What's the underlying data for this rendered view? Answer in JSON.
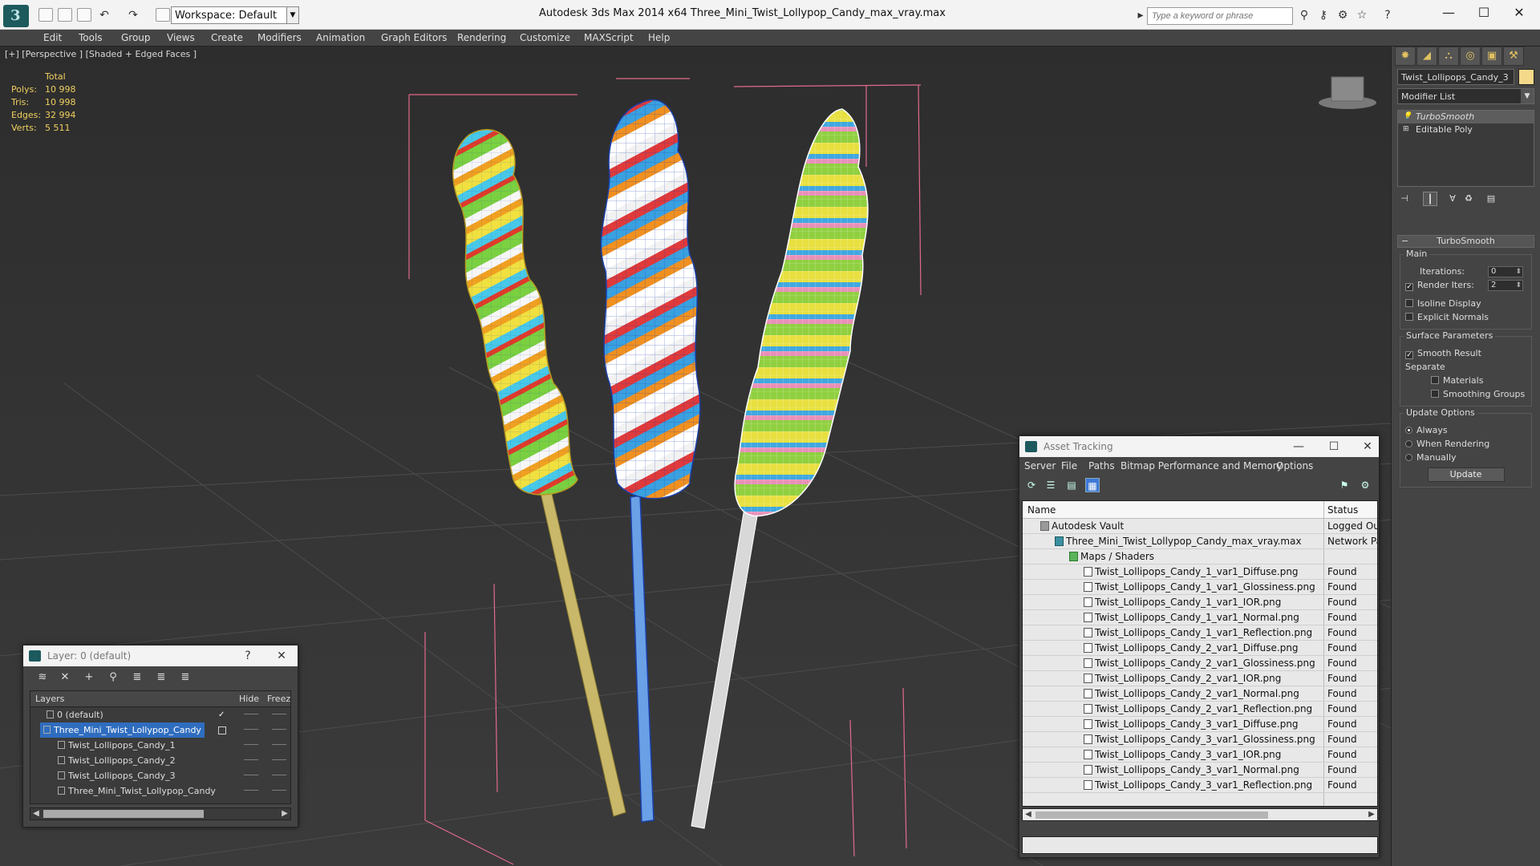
{
  "app": {
    "title": "Autodesk 3ds Max  2014 x64     Three_Mini_Twist_Lollypop_Candy_max_vray.max",
    "workspace": "Workspace: Default",
    "search_placeholder": "Type a keyword or phrase"
  },
  "menu": [
    "Edit",
    "Tools",
    "Group",
    "Views",
    "Create",
    "Modifiers",
    "Animation",
    "Graph Editors",
    "Rendering",
    "Customize",
    "MAXScript",
    "Help"
  ],
  "viewport": {
    "label": "[+] [Perspective ] [Shaded + Edged Faces ]",
    "stats": {
      "header": "Total",
      "rows": [
        {
          "label": "Polys:",
          "value": "10 998"
        },
        {
          "label": "Tris:",
          "value": "10 998"
        },
        {
          "label": "Edges:",
          "value": "32 994"
        },
        {
          "label": "Verts:",
          "value": "5 511"
        }
      ]
    }
  },
  "command_panel": {
    "object_name": "Twist_Lollipops_Candy_3",
    "object_color": "#f4d98a",
    "modifier_list": "Modifier List",
    "stack": [
      {
        "label": "TurboSmooth",
        "selected": true
      },
      {
        "label": "Editable Poly",
        "selected": false
      }
    ],
    "turbosmooth": {
      "title": "TurboSmooth",
      "main_label": "Main",
      "iterations_label": "Iterations:",
      "iterations_value": "0",
      "render_iters_label": "Render Iters:",
      "render_iters_value": "2",
      "isoline_label": "Isoline Display",
      "explicit_normals_label": "Explicit Normals",
      "surface_label": "Surface Parameters",
      "smooth_result_label": "Smooth Result",
      "separate_label": "Separate",
      "materials_label": "Materials",
      "smoothing_groups_label": "Smoothing Groups",
      "update_options_label": "Update Options",
      "always_label": "Always",
      "when_rendering_label": "When Rendering",
      "manually_label": "Manually",
      "update_button": "Update"
    }
  },
  "layer_dialog": {
    "title": "Layer: 0 (default)",
    "help": "?",
    "close": "✕",
    "col_layers": "Layers",
    "col_hide": "Hide",
    "col_freeze": "Freez",
    "rows": [
      {
        "name": "0 (default)",
        "indent": 1,
        "selected": false,
        "check": "✓"
      },
      {
        "name": "Three_Mini_Twist_Lollypop_Candy",
        "indent": 1,
        "selected": true,
        "check": ""
      },
      {
        "name": "Twist_Lollipops_Candy_1",
        "indent": 2,
        "selected": false,
        "check": ""
      },
      {
        "name": "Twist_Lollipops_Candy_2",
        "indent": 2,
        "selected": false,
        "check": ""
      },
      {
        "name": "Twist_Lollipops_Candy_3",
        "indent": 2,
        "selected": false,
        "check": ""
      },
      {
        "name": "Three_Mini_Twist_Lollypop_Candy",
        "indent": 2,
        "selected": false,
        "check": ""
      }
    ]
  },
  "asset_dialog": {
    "title": "Asset Tracking",
    "menu": [
      "Server",
      "File",
      "Paths",
      "Bitmap Performance and Memory",
      "Options"
    ],
    "col_name": "Name",
    "col_status": "Status",
    "rows": [
      {
        "name": "Autodesk Vault",
        "status": "Logged Ou",
        "level": 0,
        "icon": "vault"
      },
      {
        "name": "Three_Mini_Twist_Lollypop_Candy_max_vray.max",
        "status": "Network Pa",
        "level": 1,
        "icon": "max"
      },
      {
        "name": "Maps / Shaders",
        "status": "",
        "level": 2,
        "icon": "maps"
      },
      {
        "name": "Twist_Lollipops_Candy_1_var1_Diffuse.png",
        "status": "Found",
        "level": 3,
        "icon": "file"
      },
      {
        "name": "Twist_Lollipops_Candy_1_var1_Glossiness.png",
        "status": "Found",
        "level": 3,
        "icon": "file"
      },
      {
        "name": "Twist_Lollipops_Candy_1_var1_IOR.png",
        "status": "Found",
        "level": 3,
        "icon": "file"
      },
      {
        "name": "Twist_Lollipops_Candy_1_var1_Normal.png",
        "status": "Found",
        "level": 3,
        "icon": "file"
      },
      {
        "name": "Twist_Lollipops_Candy_1_var1_Reflection.png",
        "status": "Found",
        "level": 3,
        "icon": "file"
      },
      {
        "name": "Twist_Lollipops_Candy_2_var1_Diffuse.png",
        "status": "Found",
        "level": 3,
        "icon": "file"
      },
      {
        "name": "Twist_Lollipops_Candy_2_var1_Glossiness.png",
        "status": "Found",
        "level": 3,
        "icon": "file"
      },
      {
        "name": "Twist_Lollipops_Candy_2_var1_IOR.png",
        "status": "Found",
        "level": 3,
        "icon": "file"
      },
      {
        "name": "Twist_Lollipops_Candy_2_var1_Normal.png",
        "status": "Found",
        "level": 3,
        "icon": "file"
      },
      {
        "name": "Twist_Lollipops_Candy_2_var1_Reflection.png",
        "status": "Found",
        "level": 3,
        "icon": "file"
      },
      {
        "name": "Twist_Lollipops_Candy_3_var1_Diffuse.png",
        "status": "Found",
        "level": 3,
        "icon": "file"
      },
      {
        "name": "Twist_Lollipops_Candy_3_var1_Glossiness.png",
        "status": "Found",
        "level": 3,
        "icon": "file"
      },
      {
        "name": "Twist_Lollipops_Candy_3_var1_IOR.png",
        "status": "Found",
        "level": 3,
        "icon": "file"
      },
      {
        "name": "Twist_Lollipops_Candy_3_var1_Normal.png",
        "status": "Found",
        "level": 3,
        "icon": "file"
      },
      {
        "name": "Twist_Lollipops_Candy_3_var1_Reflection.png",
        "status": "Found",
        "level": 3,
        "icon": "file"
      }
    ]
  },
  "colors": {
    "selection": "#2f6dbf",
    "stats_text": "#f0d060",
    "bounding_box": "#e26a8c"
  }
}
